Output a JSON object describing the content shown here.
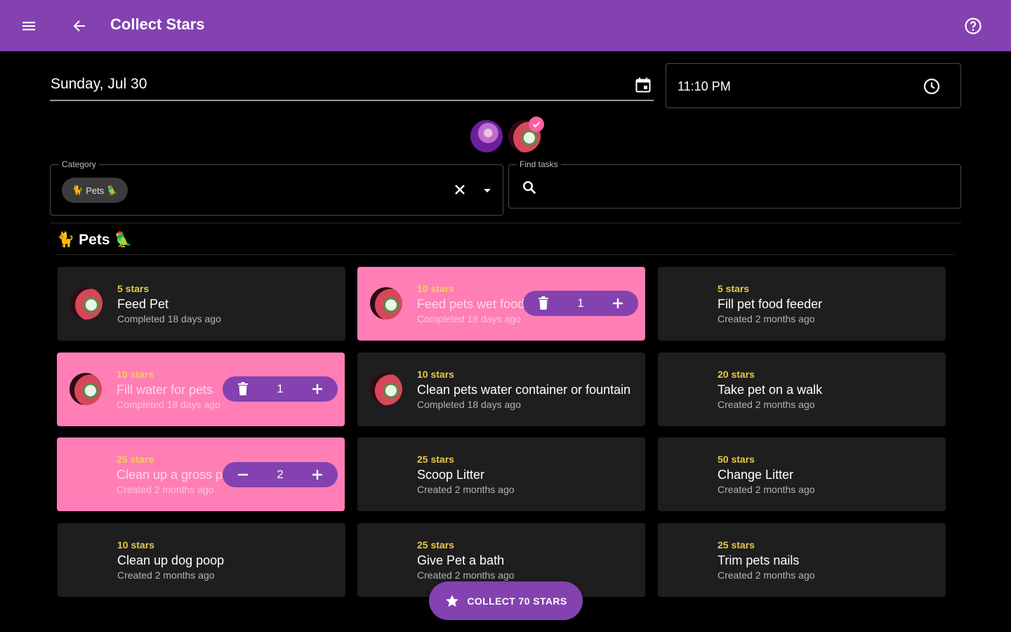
{
  "app_bar": {
    "title": "Collect Stars",
    "color": "#8342b0"
  },
  "date_field": {
    "value": "Sunday, Jul 30"
  },
  "time_field": {
    "value": "11:10 PM"
  },
  "category": {
    "label": "Category",
    "chip": "Pets"
  },
  "find_tasks": {
    "label": "Find tasks"
  },
  "section": {
    "title": "Pets"
  },
  "tasks": [
    {
      "stars": "5 stars",
      "name": "Feed Pet",
      "sub": "Completed 18 days ago",
      "selected": false
    },
    {
      "stars": "10 stars",
      "name": "Feed pets wet food",
      "sub": "Completed 18 days ago",
      "selected": true,
      "qty": "1"
    },
    {
      "stars": "5 stars",
      "name": "Fill pet food feeder",
      "sub": "Created 2 months ago",
      "selected": false
    },
    {
      "stars": "10 stars",
      "name": "Fill water for pets",
      "sub": "Completed 18 days ago",
      "selected": true,
      "qty": "1"
    },
    {
      "stars": "10 stars",
      "name": "Clean pets water container or fountain",
      "sub": "Completed 18 days ago",
      "selected": false
    },
    {
      "stars": "20 stars",
      "name": "Take pet on a walk",
      "sub": "Created 2 months ago",
      "selected": false
    },
    {
      "stars": "25 stars",
      "name": "Clean up a gross pet mess",
      "sub": "Created 2 months ago",
      "selected": true,
      "qty": "2"
    },
    {
      "stars": "25 stars",
      "name": "Scoop Litter",
      "sub": "Created 2 months ago",
      "selected": false
    },
    {
      "stars": "50 stars",
      "name": "Change Litter",
      "sub": "Created 2 months ago",
      "selected": false
    },
    {
      "stars": "10 stars",
      "name": "Clean up dog poop",
      "sub": "Created 2 months ago",
      "selected": false
    },
    {
      "stars": "25 stars",
      "name": "Give Pet a bath",
      "sub": "Created 2 months ago",
      "selected": false
    },
    {
      "stars": "25 stars",
      "name": "Trim pets nails",
      "sub": "Created 2 months ago",
      "selected": false
    }
  ],
  "fab": {
    "label": "COLLECT 70 STARS"
  },
  "colors": {
    "accent": "#8342b0",
    "selected_card": "#ff7eb6",
    "stars_text": "#e8c84a",
    "card_bg": "#1e1e1e"
  },
  "icons": [
    "menu-icon",
    "arrow-back-icon",
    "help-icon",
    "calendar-icon",
    "clock-icon",
    "close-icon",
    "dropdown-arrow-icon",
    "search-icon",
    "delete-icon",
    "minus-icon",
    "plus-icon",
    "star-icon",
    "checkmark-icon"
  ]
}
